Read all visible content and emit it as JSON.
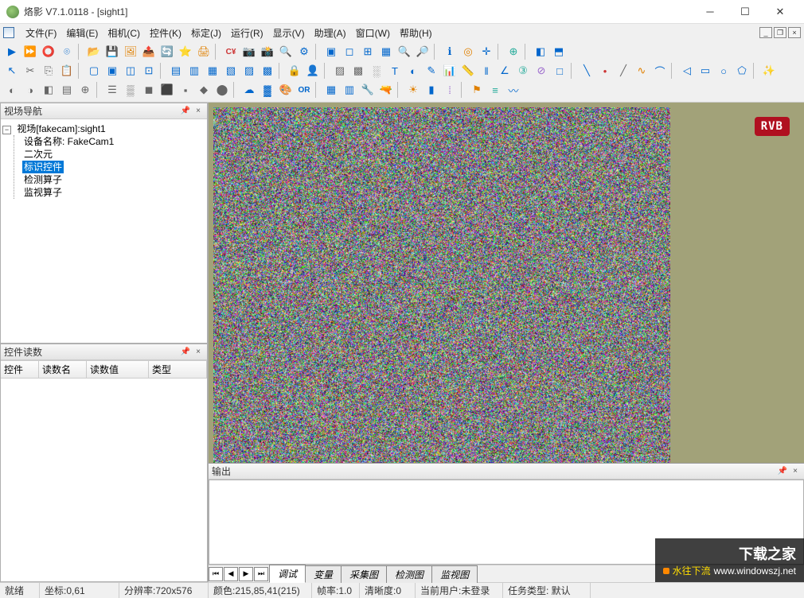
{
  "titlebar": {
    "title": "烙影 V7.1.0118 - [sight1]"
  },
  "menu": {
    "items": [
      {
        "label": "文件(F)"
      },
      {
        "label": "编辑(E)"
      },
      {
        "label": "相机(C)"
      },
      {
        "label": "控件(K)"
      },
      {
        "label": "标定(J)"
      },
      {
        "label": "运行(R)"
      },
      {
        "label": "显示(V)"
      },
      {
        "label": "助理(A)"
      },
      {
        "label": "窗口(W)"
      },
      {
        "label": "帮助(H)"
      }
    ]
  },
  "nav_panel": {
    "title": "视场导航",
    "root": "视场[fakecam]:sight1",
    "children": [
      {
        "label": "设备名称: FakeCam1"
      },
      {
        "label": "二次元"
      },
      {
        "label": "标识控件",
        "selected": true
      },
      {
        "label": "检测算子"
      },
      {
        "label": "监视算子"
      }
    ]
  },
  "read_panel": {
    "title": "控件读数",
    "columns": [
      "控件",
      "读数名",
      "读数值",
      "类型"
    ]
  },
  "viewport": {
    "badge": "RVB"
  },
  "output_panel": {
    "title": "输出",
    "tabs": [
      "调试",
      "变量",
      "采集图",
      "检测图",
      "监视图"
    ],
    "active_tab": 0
  },
  "statusbar": {
    "ready": "就绪",
    "coord": "坐标:0,61",
    "resolution": "分辨率:720x576",
    "color": "颜色:215,85,41(215)",
    "fps": "帧率:1.0",
    "clarity": "清晰度:0",
    "user": "当前用户:未登录",
    "task": "任务类型: 默认"
  },
  "watermark": {
    "line1": "下载之家",
    "line2_prefix": "水往下流",
    "line2_url": "www.windowszj.net"
  }
}
